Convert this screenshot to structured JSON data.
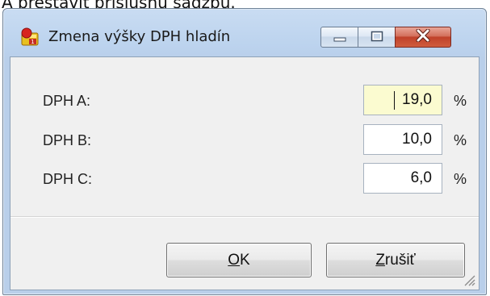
{
  "background_caption": "A prestaviť príslušnú sadzbu.",
  "window": {
    "title": "Zmena výšky DPH hladín",
    "icon": "app-icon"
  },
  "title_buttons": {
    "minimize_icon": "minimize-icon",
    "maximize_icon": "maximize-icon",
    "close_icon": "close-icon"
  },
  "rows": [
    {
      "label": "DPH A:",
      "value": "19,0",
      "unit": "%",
      "focused": true
    },
    {
      "label": "DPH B:",
      "value": "10,0",
      "unit": "%",
      "focused": false
    },
    {
      "label": "DPH C:",
      "value": "6,0",
      "unit": "%",
      "focused": false
    }
  ],
  "buttons": {
    "ok": {
      "accel": "O",
      "rest": "K"
    },
    "cancel": {
      "accel": "Z",
      "rest": "rušiť"
    }
  },
  "colors": {
    "focused_field_bg": "#fbfbd0",
    "close_button_red": "#c0412a",
    "titlebar_blue": "#bcd3ee"
  }
}
